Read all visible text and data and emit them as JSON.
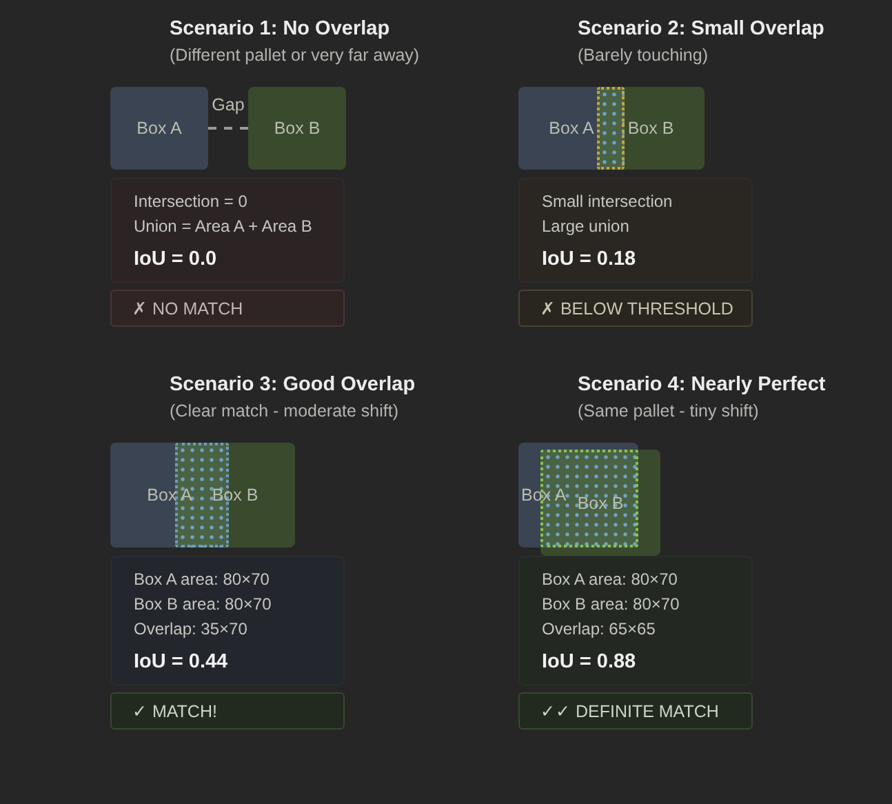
{
  "scenarios": [
    {
      "title": "Scenario 1: No Overlap",
      "subtitle": "(Different pallet or very far away)",
      "kind": "separate",
      "box_a": "Box A",
      "box_b": "Box B",
      "gap_label": "Gap",
      "details": [
        "Intersection = 0",
        "Union = Area A + Area B"
      ],
      "iou": "IoU = 0.0",
      "verdict": {
        "kind": "fail",
        "text": "✗ NO MATCH"
      }
    },
    {
      "title": "Scenario 2: Small Overlap",
      "subtitle": "(Barely touching)",
      "kind": "touching",
      "box_a": "Box A",
      "box_b": "Box B",
      "details": [
        "Small intersection",
        "Large union"
      ],
      "iou": "IoU = 0.18",
      "verdict": {
        "kind": "warn",
        "text": "✗ BELOW THRESHOLD"
      }
    },
    {
      "title": "Scenario 3: Good Overlap",
      "subtitle": "(Clear match - moderate shift)",
      "kind": "partial",
      "box_a": "Box A",
      "box_b": "Box B",
      "details": [
        "Box A area: 80×70",
        "Box B area: 80×70",
        "Overlap: 35×70"
      ],
      "iou": "IoU = 0.44",
      "verdict": {
        "kind": "pass",
        "text": "✓ MATCH!"
      }
    },
    {
      "title": "Scenario 4: Nearly Perfect",
      "subtitle": "(Same pallet - tiny shift)",
      "kind": "near",
      "box_a": "Box A",
      "box_b": "Box B",
      "details": [
        "Box A area: 80×70",
        "Box B area: 80×70",
        "Overlap: 65×65"
      ],
      "iou": "IoU = 0.88",
      "verdict": {
        "kind": "pass",
        "text": "✓✓ DEFINITE MATCH"
      }
    }
  ]
}
